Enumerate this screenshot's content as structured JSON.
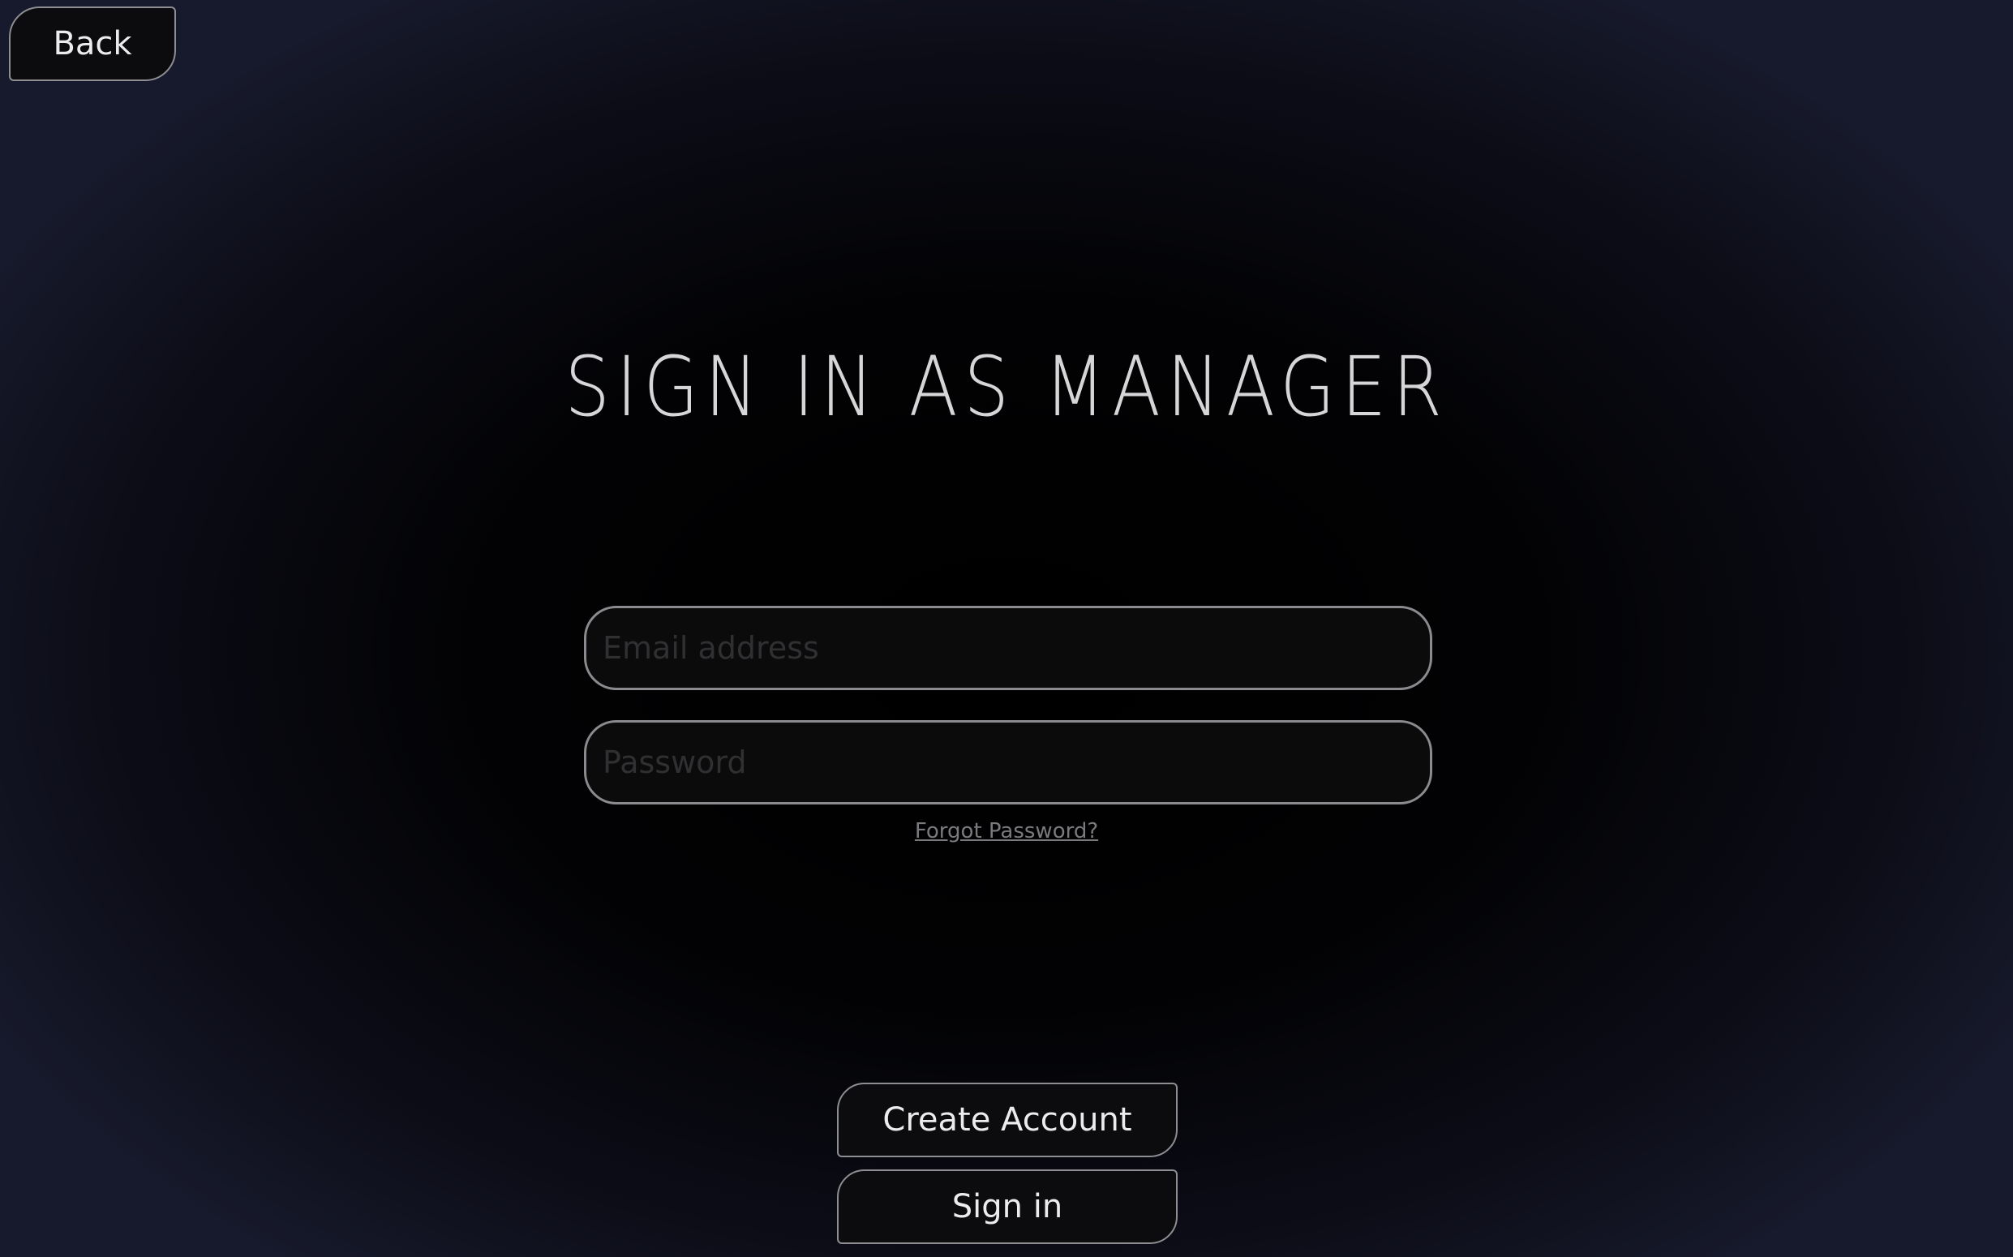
{
  "header": {
    "back_label": "Back"
  },
  "main": {
    "title": "SIGN IN AS MANAGER",
    "email": {
      "placeholder": "Email address",
      "value": ""
    },
    "password": {
      "placeholder": "Password",
      "value": ""
    },
    "forgot_password_label": "Forgot Password?",
    "create_account_label": "Create Account",
    "sign_in_label": "Sign in"
  },
  "colors": {
    "background_center": "#000000",
    "background_edge": "#171a2c",
    "button_fill": "#0c0c0e",
    "border": "#8e8e92",
    "title_text": "#d6d6d8"
  }
}
